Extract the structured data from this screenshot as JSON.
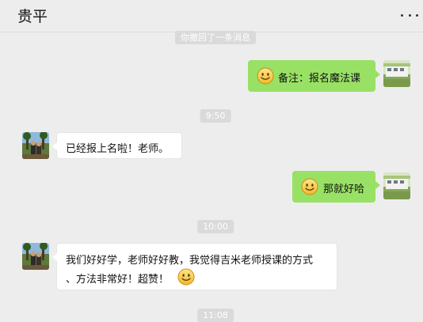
{
  "header": {
    "title": "贵平",
    "more_icon": "more-dots-icon"
  },
  "system_messages": {
    "recall_notice": "你撤回了一条消息",
    "time_1": "9:50",
    "time_2": "10:00",
    "time_3": "11:08"
  },
  "messages": [
    {
      "side": "right",
      "text": "备注：报名魔法课",
      "emoji": "smile-emoji-icon"
    },
    {
      "side": "left",
      "text": "已经报上名啦！老师。"
    },
    {
      "side": "right",
      "text": "那就好哈",
      "emoji": "smile-emoji-icon"
    },
    {
      "side": "left",
      "line1": "我们好好学，老师好好教，我觉得吉米老师授课的方式",
      "line2": "、方法非常好！超赞！",
      "emoji": "smile-emoji-icon"
    }
  ],
  "colors": {
    "background": "#ededed",
    "sent_bubble": "#98e165",
    "received_bubble": "#ffffff",
    "system_badge": "#dadada"
  }
}
